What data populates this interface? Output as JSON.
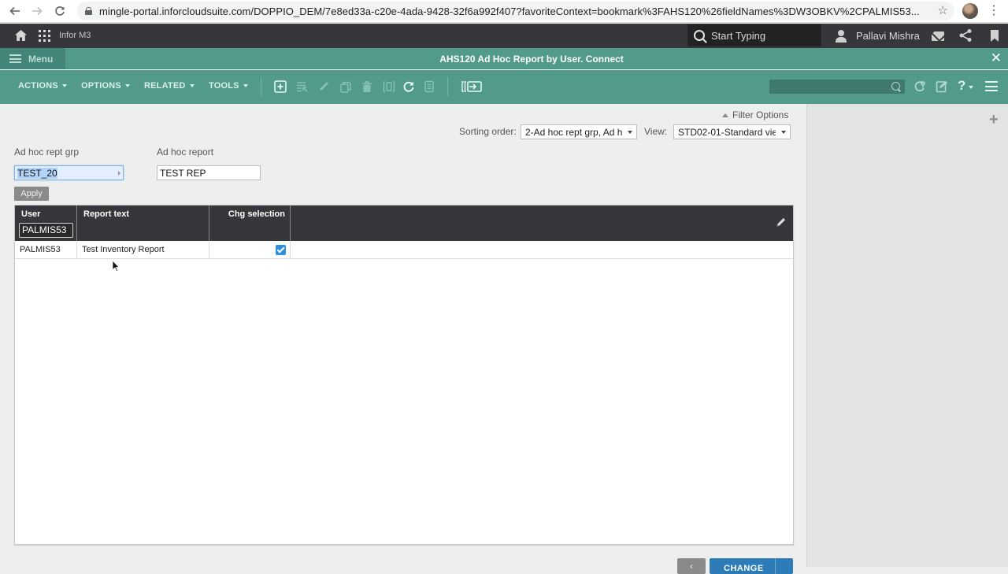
{
  "browser": {
    "url": "mingle-portal.inforcloudsuite.com/DOPPIO_DEM/7e8ed33a-c20e-4ada-9428-32f6a992f407?favoriteContext=bookmark%3FAHS120%26fieldNames%3DW3OBKV%2CPALMIS53...",
    "back_icon": "arrow-left",
    "forward_icon": "arrow-right",
    "reload_icon": "reload",
    "star_icon": "star-outline",
    "menu_icon": "vertical-ellipsis"
  },
  "portal_bar": {
    "app_name": "Infor M3",
    "search_placeholder": "Start Typing",
    "user_name": "Pallavi Mishra"
  },
  "program_header": {
    "menu_label": "Menu",
    "title": "AHS120 Ad Hoc Report by User. Connect",
    "close_glyph": "✕"
  },
  "toolbar": {
    "menus": [
      {
        "label": "ACTIONS"
      },
      {
        "label": "OPTIONS"
      },
      {
        "label": "RELATED"
      },
      {
        "label": "TOOLS"
      }
    ],
    "icons": [
      "create",
      "select-list",
      "edit",
      "copy",
      "delete",
      "display",
      "refresh",
      "clear",
      "panel-switch"
    ],
    "search_value": "",
    "help_glyph": "?"
  },
  "filter": {
    "toggle_label": "Filter Options",
    "sorting_label": "Sorting order:",
    "sorting_value": "2-Ad hoc rept grp, Ad h",
    "view_label": "View:",
    "view_value": "STD02-01-Standard vie",
    "fields": [
      {
        "label": "Ad hoc rept grp",
        "value": "TEST_20"
      },
      {
        "label": "Ad hoc report",
        "value": "TEST REP"
      }
    ],
    "apply_label": "Apply"
  },
  "grid": {
    "columns": [
      {
        "label": "User",
        "filter_value": "PALMIS53"
      },
      {
        "label": "Report text"
      },
      {
        "label": "Chg selection"
      }
    ],
    "rows": [
      {
        "user": "PALMIS53",
        "report_text": "Test Inventory Report",
        "chg_selection": true
      }
    ]
  },
  "footer": {
    "back_glyph": "‹",
    "change_label": "CHANGE"
  },
  "side_panel": {
    "add_glyph": "+"
  }
}
